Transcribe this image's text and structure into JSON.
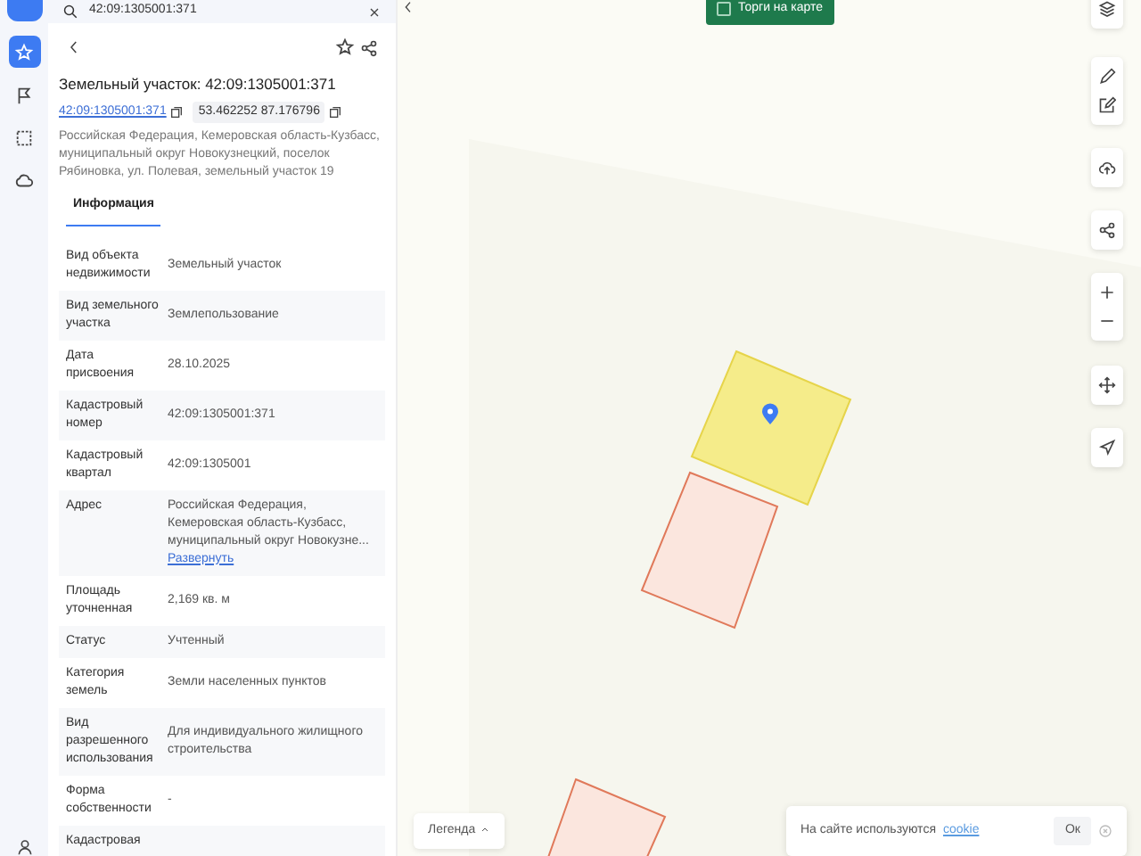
{
  "rail": [
    {
      "kind": "star",
      "selected": true
    },
    {
      "kind": "flag",
      "selected": false
    },
    {
      "kind": "select",
      "selected": false
    },
    {
      "kind": "cloud",
      "selected": false
    }
  ],
  "search": {
    "value": "42:09:1305001:371"
  },
  "object": {
    "title": "Земельный участок: 42:09:1305001:371",
    "cadastral_number": "42:09:1305001:371",
    "coordinates": "53.462252 87.176796",
    "address": "Российская Федерация, Кемеровская область-Кузбасс, муниципальный округ Новокузнецкий, поселок Рябиновка, ул. Полевая, земельный участок 19"
  },
  "tabs": [
    {
      "label": "Информация",
      "selected": true
    }
  ],
  "rows": [
    {
      "label": "Вид объекта недвижимости",
      "value": "Земельный участок"
    },
    {
      "label": "Вид земельного участка",
      "value": "Землепользование"
    },
    {
      "label": "Дата присвоения",
      "value": "28.10.2025"
    },
    {
      "label": "Кадастровый номер",
      "value": "42:09:1305001:371"
    },
    {
      "label": "Кадастровый квартал",
      "value": "42:09:1305001"
    },
    {
      "label": "Адрес",
      "value": "Российская Федерация, Кемеровская область-Кузбасс, муниципальный округ Новокузне...",
      "link": "Развернуть"
    },
    {
      "label": "Площадь уточненная",
      "value": "2,169 кв. м"
    },
    {
      "label": "Статус",
      "value": "Учтенный"
    },
    {
      "label": "Категория земель",
      "value": "Земли населенных пунктов"
    },
    {
      "label": "Вид разрешенного использования",
      "value": "Для индивидуального жилищного строительства"
    },
    {
      "label": "Форма собственности",
      "value": "-"
    },
    {
      "label": "Кадастровая"
    }
  ],
  "map": {
    "auction_toggle": {
      "label": "Торги на карте",
      "checked": false
    },
    "parcels": [
      {
        "selected": true
      },
      {
        "selected": false
      },
      {
        "selected": false
      }
    ],
    "legend": {
      "label": "Легенда"
    },
    "cookie": {
      "text": "На сайте используются",
      "link": "cookie",
      "button": "Ок"
    }
  }
}
